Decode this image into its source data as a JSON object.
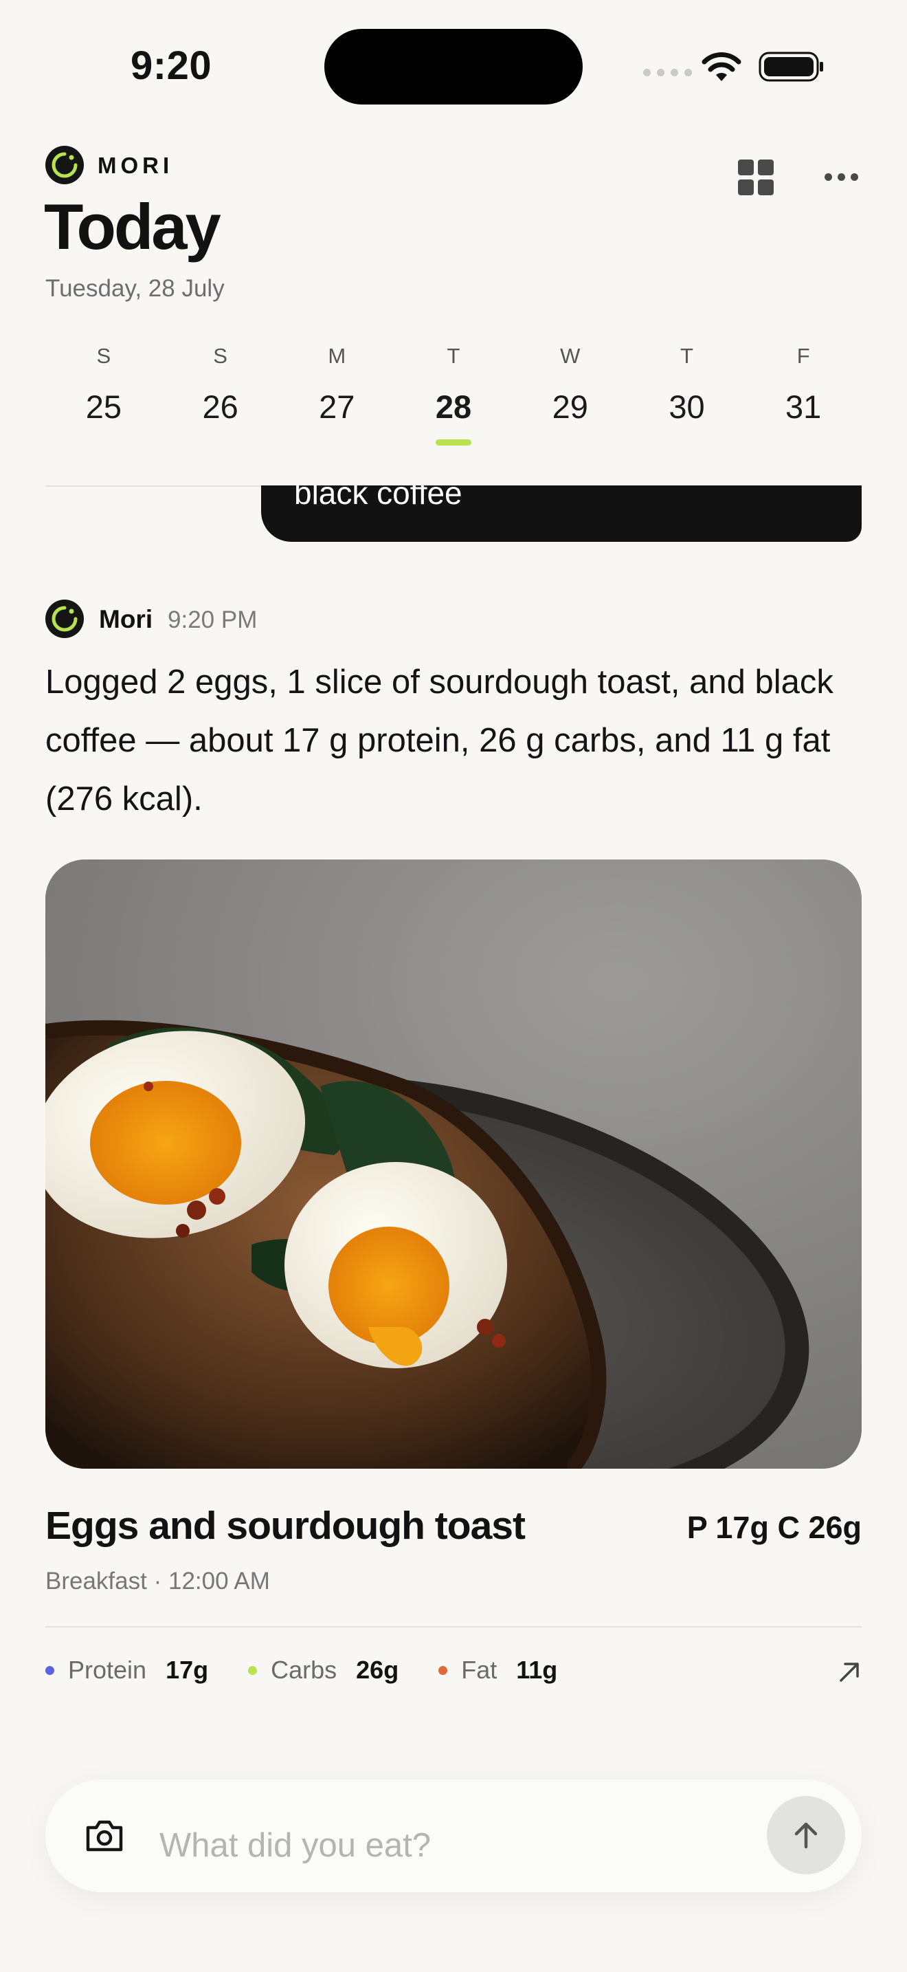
{
  "status_bar": {
    "time": "9:20"
  },
  "header": {
    "brand": "MORI",
    "title": "Today",
    "date": "Tuesday, 28 July",
    "icons": [
      "grid-icon",
      "more-icon"
    ]
  },
  "week": {
    "days": [
      {
        "letter": "S",
        "number": "25",
        "active": false
      },
      {
        "letter": "S",
        "number": "26",
        "active": false
      },
      {
        "letter": "M",
        "number": "27",
        "active": false
      },
      {
        "letter": "T",
        "number": "28",
        "active": true
      },
      {
        "letter": "W",
        "number": "29",
        "active": false
      },
      {
        "letter": "T",
        "number": "30",
        "active": false
      },
      {
        "letter": "F",
        "number": "31",
        "active": false
      }
    ],
    "indicator_color": "#b7e34e"
  },
  "chat": {
    "user_bubble_text": "black coffee",
    "assistant": {
      "name": "Mori",
      "time": "9:20 PM",
      "message": "Logged 2 eggs, 1 slice of sourdough toast, and black coffee — about 17 g protein, 26 g carbs, and 11 g fat (276 kcal)."
    }
  },
  "meal": {
    "title": "Eggs and sourdough toast",
    "macros_summary": "P 17g  C 26g",
    "category": "Breakfast",
    "time": "12:00 AM",
    "macros": [
      {
        "label": "Protein",
        "value": "17g",
        "color": "#5b63e0"
      },
      {
        "label": "Carbs",
        "value": "26g",
        "color": "#b7e34e"
      },
      {
        "label": "Fat",
        "value": "11g",
        "color": "#e0683c"
      }
    ]
  },
  "composer": {
    "placeholder": "What did you eat?",
    "value": ""
  }
}
